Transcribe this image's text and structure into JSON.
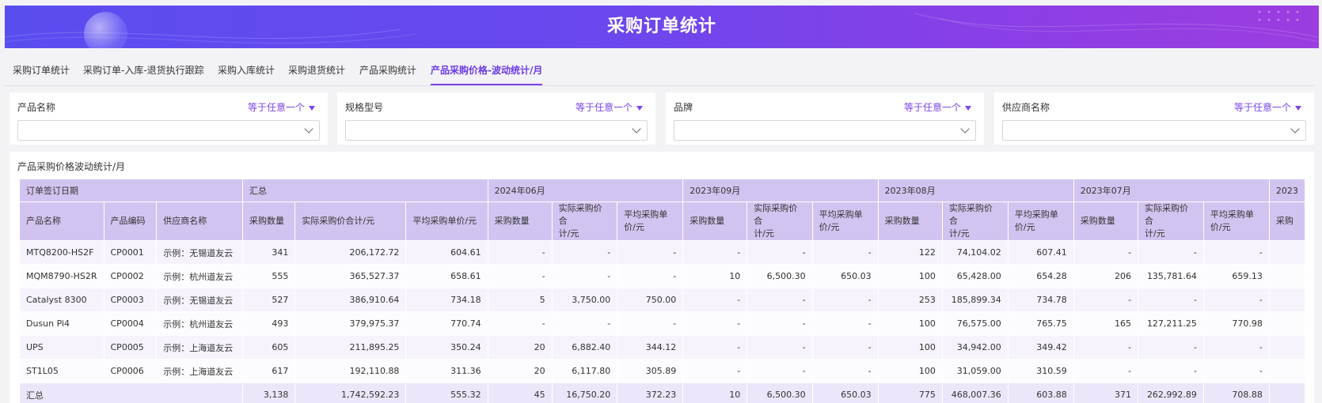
{
  "banner": {
    "title": "采购订单统计"
  },
  "tabs": [
    {
      "label": "采购订单统计"
    },
    {
      "label": "采购订单-入库-退货执行跟踪"
    },
    {
      "label": "采购入库统计"
    },
    {
      "label": "采购退货统计"
    },
    {
      "label": "产品采购统计"
    },
    {
      "label": "产品采购价格-波动统计/月",
      "active": true
    }
  ],
  "filters": [
    {
      "label": "产品名称",
      "operator": "等于任意一个",
      "value": ""
    },
    {
      "label": "规格型号",
      "operator": "等于任意一个",
      "value": ""
    },
    {
      "label": "品牌",
      "operator": "等于任意一个",
      "value": ""
    },
    {
      "label": "供应商名称",
      "operator": "等于任意一个",
      "value": ""
    }
  ],
  "panel": {
    "title": "产品采购价格波动统计/月"
  },
  "table": {
    "group_header": "订单签订日期",
    "groups": [
      "汇总",
      "2024年06月",
      "2023年09月",
      "2023年08月",
      "2023年07月",
      "2023"
    ],
    "columns": {
      "product_name": "产品名称",
      "product_code": "产品编码",
      "supplier": "供应商名称",
      "qty": "采购数量",
      "total": "实际采购价合计/元",
      "avg": "平均采购单价/元",
      "total_wrapped": "实际采购价合\n计/元",
      "avg_wrapped": "平均采购单\n价/元",
      "qty_partial": "采购"
    },
    "rows": [
      {
        "name": "MTQ8200-HS2F",
        "code": "CP0001",
        "supplier": "示例：无锡道友云",
        "sum": [
          "341",
          "206,172.72",
          "604.61"
        ],
        "m2406": [
          "-",
          "-",
          "-"
        ],
        "m2309": [
          "-",
          "-",
          "-"
        ],
        "m2308": [
          "122",
          "74,104.02",
          "607.41"
        ],
        "m2307": [
          "-",
          "-",
          "-"
        ]
      },
      {
        "name": "MQM8790-HS2R",
        "code": "CP0002",
        "supplier": "示例：杭州道友云",
        "sum": [
          "555",
          "365,527.37",
          "658.61"
        ],
        "m2406": [
          "-",
          "-",
          "-"
        ],
        "m2309": [
          "10",
          "6,500.30",
          "650.03"
        ],
        "m2308": [
          "100",
          "65,428.00",
          "654.28"
        ],
        "m2307": [
          "206",
          "135,781.64",
          "659.13"
        ]
      },
      {
        "name": "Catalyst 8300",
        "code": "CP0003",
        "supplier": "示例：无锡道友云",
        "sum": [
          "527",
          "386,910.64",
          "734.18"
        ],
        "m2406": [
          "5",
          "3,750.00",
          "750.00"
        ],
        "m2309": [
          "-",
          "-",
          "-"
        ],
        "m2308": [
          "253",
          "185,899.34",
          "734.78"
        ],
        "m2307": [
          "-",
          "-",
          "-"
        ]
      },
      {
        "name": "Dusun Pi4",
        "code": "CP0004",
        "supplier": "示例：杭州道友云",
        "sum": [
          "493",
          "379,975.37",
          "770.74"
        ],
        "m2406": [
          "-",
          "-",
          "-"
        ],
        "m2309": [
          "-",
          "-",
          "-"
        ],
        "m2308": [
          "100",
          "76,575.00",
          "765.75"
        ],
        "m2307": [
          "165",
          "127,211.25",
          "770.98"
        ]
      },
      {
        "name": "UPS",
        "code": "CP0005",
        "supplier": "示例：上海道友云",
        "sum": [
          "605",
          "211,895.25",
          "350.24"
        ],
        "m2406": [
          "20",
          "6,882.40",
          "344.12"
        ],
        "m2309": [
          "-",
          "-",
          "-"
        ],
        "m2308": [
          "100",
          "34,942.00",
          "349.42"
        ],
        "m2307": [
          "-",
          "-",
          "-"
        ]
      },
      {
        "name": "ST1L05",
        "code": "CP0006",
        "supplier": "示例：上海道友云",
        "sum": [
          "617",
          "192,110.88",
          "311.36"
        ],
        "m2406": [
          "20",
          "6,117.80",
          "305.89"
        ],
        "m2309": [
          "-",
          "-",
          "-"
        ],
        "m2308": [
          "100",
          "31,059.00",
          "310.59"
        ],
        "m2307": [
          "-",
          "-",
          "-"
        ]
      }
    ],
    "total": {
      "label": "汇总",
      "sum": [
        "3,138",
        "1,742,592.23",
        "555.32"
      ],
      "m2406": [
        "45",
        "16,750.20",
        "372.23"
      ],
      "m2309": [
        "10",
        "6,500.30",
        "650.03"
      ],
      "m2308": [
        "775",
        "468,007.36",
        "603.88"
      ],
      "m2307": [
        "371",
        "262,992.89",
        "708.88"
      ]
    }
  }
}
